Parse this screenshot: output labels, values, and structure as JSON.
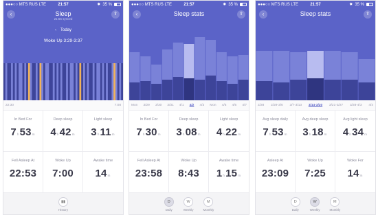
{
  "status": {
    "carrier": "●●●○○ MTS RUS  LTE",
    "time": "21:57",
    "bt": "✸",
    "battery": "35 %"
  },
  "screen1": {
    "title": "Sleep",
    "subtitle": "21:56 synced",
    "day": "Today",
    "woke": "Woke Up 3:29-3:37",
    "axis": [
      "22:30",
      "7:08"
    ],
    "stats": [
      {
        "label": "In Bed For",
        "h": "7",
        "hu": "h",
        "m": "53",
        "mu": "m"
      },
      {
        "label": "Deep sleep",
        "h": "4",
        "hu": "h",
        "m": "42",
        "mu": "m"
      },
      {
        "label": "Light sleep",
        "h": "3",
        "hu": "h",
        "m": "11",
        "mu": "m"
      },
      {
        "label": "Fell Asleep At",
        "value": "22:53"
      },
      {
        "label": "Woke Up",
        "value": "7:00"
      },
      {
        "label": "Awake time",
        "value": "14",
        "unit": "m"
      }
    ],
    "tabs": [
      {
        "label": "History",
        "icon": "bar-chart-icon"
      }
    ]
  },
  "screen2": {
    "title": "Sleep stats",
    "axis": [
      "Mon",
      "3/29",
      "3/30",
      "3/31",
      "4/1",
      "4/2",
      "4/3",
      "Mon",
      "4/5",
      "4/6",
      "4/7"
    ],
    "selected_axis_index": 5,
    "stats": [
      {
        "label": "In Bed For",
        "h": "7",
        "hu": "h",
        "m": "30",
        "mu": "m"
      },
      {
        "label": "Deep sleep",
        "h": "3",
        "hu": "h",
        "m": "08",
        "mu": "m"
      },
      {
        "label": "Light sleep",
        "h": "4",
        "hu": "h",
        "m": "22",
        "mu": "m"
      },
      {
        "label": "Fell Asleep At",
        "value": "23:58"
      },
      {
        "label": "Woke Up",
        "value": "8:43"
      },
      {
        "label": "Awake time",
        "h": "1",
        "hu": "h",
        "m": "15",
        "mu": "m"
      }
    ],
    "tabs": [
      {
        "letter": "D",
        "label": "Daily",
        "active": true
      },
      {
        "letter": "W",
        "label": "Weekly",
        "active": false
      },
      {
        "letter": "M",
        "label": "Monthly",
        "active": false
      }
    ]
  },
  "screen3": {
    "title": "Sleep stats",
    "axis": [
      "2/28",
      "2/29-3/6",
      "3/7-3/13",
      "3/14-3/20",
      "3/21-3/27",
      "3/28-4/3",
      "4/4"
    ],
    "selected_axis_index": 3,
    "stats": [
      {
        "label": "Avg sleep daily",
        "h": "7",
        "hu": "h",
        "m": "53",
        "mu": "m"
      },
      {
        "label": "Avg deep sleep",
        "h": "3",
        "hu": "h",
        "m": "18",
        "mu": "m"
      },
      {
        "label": "Avg light sleep",
        "h": "4",
        "hu": "h",
        "m": "34",
        "mu": "m"
      },
      {
        "label": "Asleep At",
        "value": "23:09"
      },
      {
        "label": "Woke Up",
        "value": "7:25"
      },
      {
        "label": "Woke For",
        "value": "14",
        "unit": "m"
      }
    ],
    "tabs": [
      {
        "letter": "D",
        "label": "Daily",
        "active": false
      },
      {
        "letter": "W",
        "label": "Weekly",
        "active": true
      },
      {
        "letter": "M",
        "label": "Monthly",
        "active": false
      }
    ]
  },
  "colors": {
    "hero": "#5b63c8",
    "deep": "#3d4499",
    "light": "#7a82d8",
    "awake": "#f0b25a",
    "selected": "#b8bcf0"
  }
}
